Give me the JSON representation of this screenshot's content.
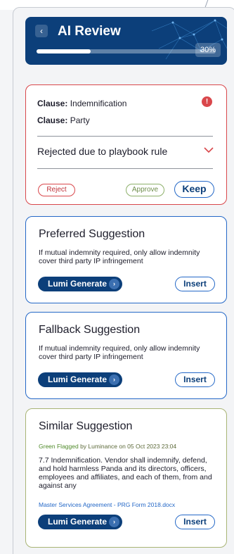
{
  "header": {
    "title": "AI Review",
    "progress_percent": 30,
    "progress_label": "30%",
    "color": "#0c3f7a"
  },
  "review_card": {
    "clause1_key": "Clause:",
    "clause1_value": "Indemnification",
    "clause2_key": "Clause:",
    "clause2_value": "Party",
    "status": "Rejected due to playbook rule",
    "info_glyph": "!",
    "reject_label": "Reject",
    "approve_label": "Approve",
    "keep_label": "Keep",
    "accent": "#d9474b"
  },
  "preferred": {
    "title": "Preferred Suggestion",
    "body": "If mutual indemnity required, only allow indemnity cover third party IP infringement",
    "generate_label": "Lumi Generate",
    "insert_label": "Insert"
  },
  "fallback": {
    "title": "Fallback Suggestion",
    "body": "If mutual indemnity required, only allow indemnity cover third party IP infringement",
    "generate_label": "Lumi Generate",
    "insert_label": "Insert"
  },
  "similar": {
    "title": "Similar Suggestion",
    "flag_status": "Green Flagged",
    "flag_meta": "by Luminance on 05 Oct 2023 23:04",
    "body": "7.7 Indemnification. Vendor shall indemnify, defend, and hold harmless Panda and its directors, officers, employees and affiliates, and each of them, from and against any",
    "document": "Master Services Agreement - PRG Form 2018.docx",
    "generate_label": "Lumi Generate",
    "insert_label": "Insert"
  },
  "icons": {
    "back": "chevron-left-icon",
    "info": "info-icon",
    "expand": "chevron-down-icon",
    "generate": "chevron-right-icon"
  }
}
